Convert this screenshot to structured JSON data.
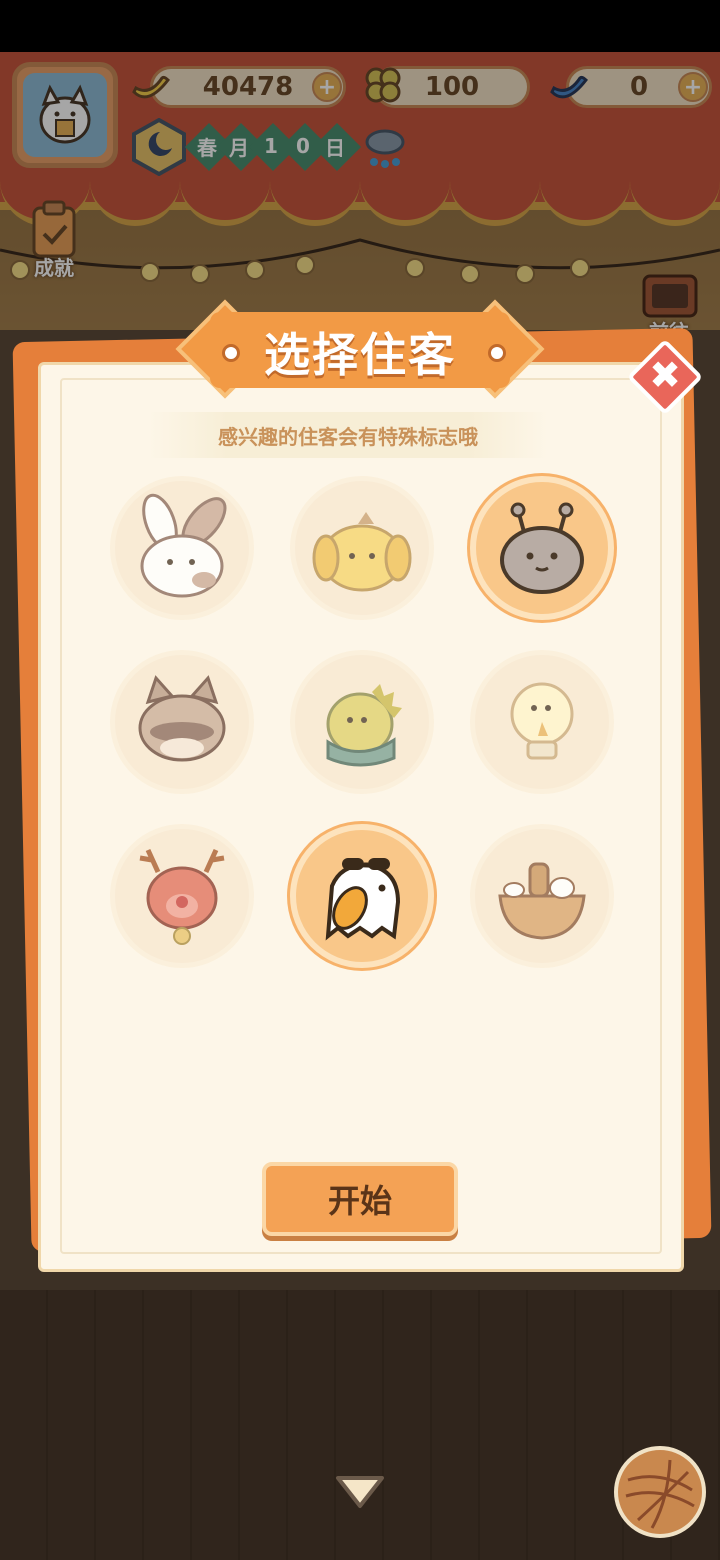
{
  "hud": {
    "bananas": "40478",
    "clovers": "100",
    "blue_bananas": "0",
    "plus": "+",
    "date_chars": [
      "春",
      "月",
      "1",
      "0",
      "日"
    ]
  },
  "side_buttons": {
    "achievements": "成就",
    "goto": "前往"
  },
  "dialog": {
    "title": "选择住客",
    "hint": "感兴趣的住客会有特殊标志哦",
    "close": "✖",
    "start_label": "开始",
    "guests": [
      {
        "name": "bunny",
        "selected": false
      },
      {
        "name": "dog",
        "selected": false
      },
      {
        "name": "slug",
        "selected": true
      },
      {
        "name": "raccoon",
        "selected": false
      },
      {
        "name": "dino",
        "selected": false
      },
      {
        "name": "lightbulb",
        "selected": false
      },
      {
        "name": "reindeer",
        "selected": false
      },
      {
        "name": "bird-sunglasses",
        "selected": true
      },
      {
        "name": "bowl",
        "selected": false
      }
    ]
  },
  "colors": {
    "accent": "#f29a45",
    "panel": "#fdf6e8",
    "close": "#e9665a"
  }
}
